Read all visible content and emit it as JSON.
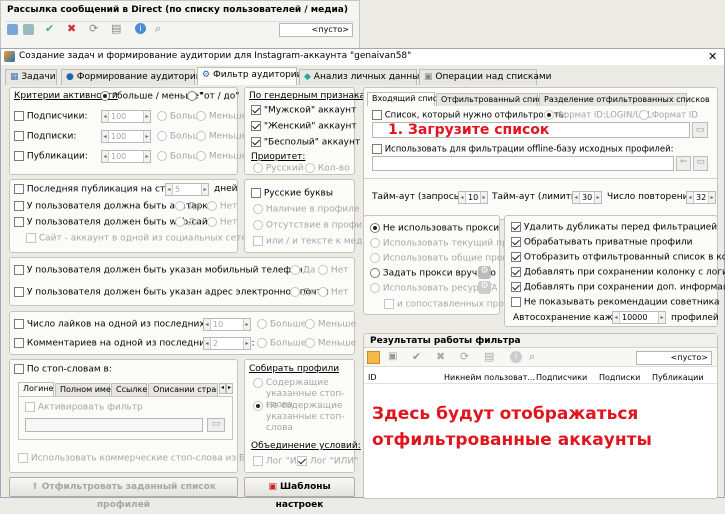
{
  "top_panel": {
    "title": "Рассылка сообщений в Direct (по списку пользователей / медиа)",
    "placeholder": "<пусто>"
  },
  "window": {
    "title": "Создание задач и формирование аудитории для Instagram-аккаунта \"genaivan58\"",
    "close": "✕"
  },
  "tabs": [
    "Задачи",
    "Формирование аудитории",
    "Фильтр аудитории",
    "Анализ личных данных",
    "Операции над списками"
  ],
  "criteria": {
    "title": "Критерии активности",
    "opt_more_less": "\"больше / меньше\"",
    "opt_from_to": "\"от / до\"",
    "rows": [
      {
        "label": "Подписчики:",
        "value": "100"
      },
      {
        "label": "Подписки:",
        "value": "100"
      },
      {
        "label": "Публикации:",
        "value": "100"
      }
    ],
    "more": "Больше",
    "less": "Меньше"
  },
  "gender": {
    "title": "По гендерным признакам",
    "items": [
      "\"Мужской\" аккаунт",
      "\"Женский\" аккаунт",
      "\"Бесполый\" аккаунт"
    ],
    "priority_title": "Приоритет:",
    "priority_opts": [
      "Русский",
      "Кол-во"
    ]
  },
  "last_pub": {
    "label": "Последняя публикация на старше",
    "value": "5",
    "unit": "дней"
  },
  "avatar": {
    "label": "У пользователя должна быть аватарка",
    "yes": "Да",
    "no": "Нет"
  },
  "website": {
    "label": "У пользователя должен быть web-сайт",
    "yes": "Да",
    "no": "Нет",
    "sub": "Сайт - аккаунт в одной из социальных сетей"
  },
  "russian": {
    "label": "Русские буквы",
    "opt1": "Наличие в профиле",
    "opt2": "Отсутствие в профиле",
    "opt3": "или / и тексте к медиа"
  },
  "phone": {
    "label": "У пользователя должен быть указан мобильный телефон",
    "yes": "Да",
    "no": "Нет"
  },
  "email": {
    "label": "У пользователя должен быть указан адрес электронной почты",
    "yes": "Да",
    "no": "Нет"
  },
  "likes": {
    "label": "Число лайков на одной из последних записей:",
    "value": "10",
    "more": "Больше",
    "less": "Меньше"
  },
  "comments": {
    "label": "Комментариев на одной из последних записей:",
    "value": "2",
    "more": "Больше",
    "less": "Меньше"
  },
  "stopwords": {
    "label": "По стоп-словам в:",
    "tabs": [
      "Логине",
      "Полном имени",
      "Ссылке",
      "Описании страни"
    ],
    "activate": "Активировать фильтр",
    "commercial": "Использовать коммерческие стоп-слова из БД SocialKit"
  },
  "collect": {
    "title": "Собирать профили",
    "opt1": "Содержащие указанные стоп-слова",
    "opt2": "Не содержащие указанные стоп-слова",
    "union_title": "Объединение условий:",
    "or1": "Лог \"И\"",
    "or2": "Лог \"ИЛИ\""
  },
  "bottom_buttons": {
    "filter": "Отфильтровать заданный список профилей",
    "templates": "Шаблоны настроек"
  },
  "right_tabs": [
    "Входящий список",
    "Отфильтрованный список",
    "Разделение отфильтрованных списков"
  ],
  "incoming": {
    "list_label": "Список, который нужно отфильтровать:",
    "fmt1": "Формат ID:LOGIN/URL",
    "fmt2": "Формат ID",
    "offline_label": "Использовать для фильтрации offline-базу исходных профилей:",
    "annotation": "1. Загрузите список"
  },
  "timeouts": {
    "t1_label": "Тайм-аут (запросы):",
    "t1": "10",
    "t2_label": "Тайм-аут (лимиты):",
    "t2": "30",
    "t3_label": "Число повторений:",
    "t3": "32"
  },
  "proxy": {
    "opts": [
      "Не использовать прокси",
      "Использовать текущий прокси",
      "Использовать общие прокси",
      "Задать прокси вручную",
      "Использовать ресурс TA"
    ],
    "sub": "и сопоставленных прокси"
  },
  "options": {
    "items": [
      "Удалить дубликаты перед фильтрацией",
      "Обрабатывать приватные профили",
      "Отобразить отфильтрованный список в конце",
      "Добавлять при сохранении колонку с логином",
      "Добавлять при сохранении доп. информацию",
      "Не показывать рекомендации советника"
    ],
    "autosave_label": "Автосохранение каждые",
    "autosave_value": "10000",
    "autosave_unit": "профилей"
  },
  "results": {
    "title": "Результаты работы фильтра",
    "placeholder": "<пусто>",
    "columns": [
      "ID",
      "Никнейм пользоват...",
      "Подписчики",
      "Подписки",
      "Публикации"
    ],
    "annotation_line1": "Здесь будут отображаться",
    "annotation_line2": "отфильтрованные аккаунты"
  }
}
